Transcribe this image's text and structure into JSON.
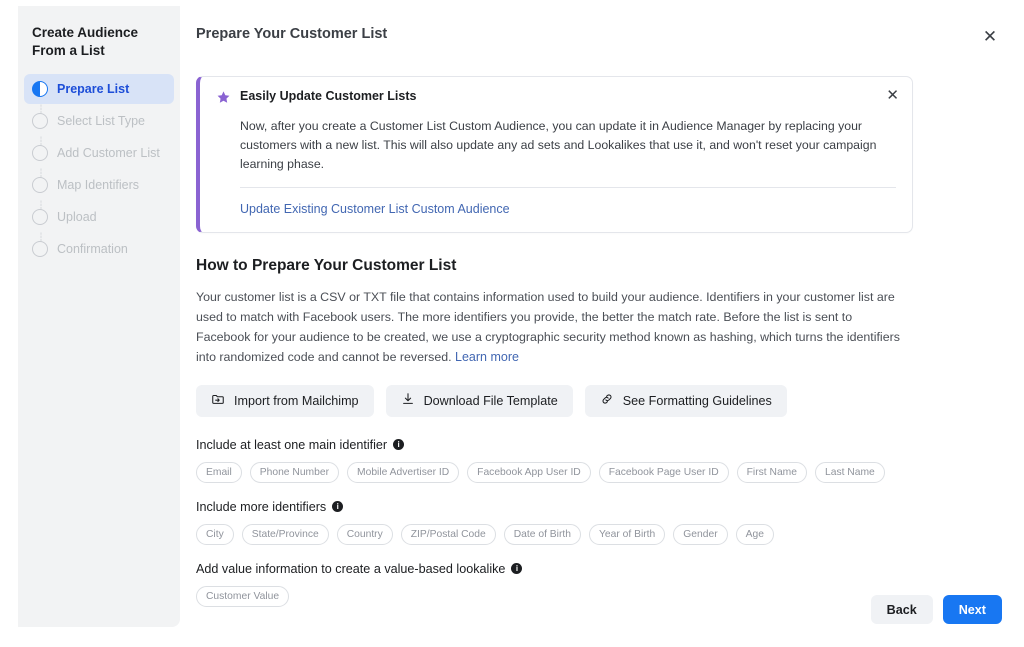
{
  "sidebar": {
    "title": "Create Audience From a List",
    "steps": [
      {
        "label": "Prepare List",
        "icon": "half-filled-circle-icon",
        "active": true
      },
      {
        "label": "Select List Type",
        "icon": "empty-circle-icon",
        "active": false
      },
      {
        "label": "Add Customer List",
        "icon": "empty-circle-icon",
        "active": false
      },
      {
        "label": "Map Identifiers",
        "icon": "empty-circle-icon",
        "active": false
      },
      {
        "label": "Upload",
        "icon": "empty-circle-icon",
        "active": false
      },
      {
        "label": "Confirmation",
        "icon": "empty-circle-icon",
        "active": false
      }
    ]
  },
  "header": {
    "title": "Prepare Your Customer List",
    "close_label": "✕"
  },
  "banner": {
    "icon": "star-icon",
    "title": "Easily Update Customer Lists",
    "body": "Now, after you create a Customer List Custom Audience, you can update it in Audience Manager by replacing your customers with a new list. This will also update any ad sets and Lookalikes that use it, and won't reset your campaign learning phase.",
    "link": "Update Existing Customer List Custom Audience",
    "close_label": "✕",
    "accent_color": "#8a63d2"
  },
  "main": {
    "heading": "How to Prepare Your Customer List",
    "paragraph": "Your customer list is a CSV or TXT file that contains information used to build your audience. Identifiers in your customer list are used to match with Facebook users. The more identifiers you provide, the better the match rate. Before the list is sent to Facebook for your audience to be created, we use a cryptographic security method known as hashing, which turns the identifiers into randomized code and cannot be reversed.",
    "paragraph_link": "Learn more",
    "actions": [
      {
        "label": "Import from Mailchimp",
        "icon": "folder-import-icon"
      },
      {
        "label": "Download File Template",
        "icon": "download-icon"
      },
      {
        "label": "See Formatting Guidelines",
        "icon": "link-icon"
      }
    ],
    "groups": [
      {
        "label": "Include at least one main identifier",
        "info_icon": "info-icon",
        "chips": [
          "Email",
          "Phone Number",
          "Mobile Advertiser ID",
          "Facebook App User ID",
          "Facebook Page User ID",
          "First Name",
          "Last Name"
        ]
      },
      {
        "label": "Include more identifiers",
        "info_icon": "info-icon",
        "chips": [
          "City",
          "State/Province",
          "Country",
          "ZIP/Postal Code",
          "Date of Birth",
          "Year of Birth",
          "Gender",
          "Age"
        ]
      },
      {
        "label": "Add value information to create a value-based lookalike",
        "info_icon": "info-icon",
        "chips": [
          "Customer Value"
        ]
      }
    ]
  },
  "footer": {
    "back_label": "Back",
    "next_label": "Next",
    "next_color": "#1877f2"
  }
}
